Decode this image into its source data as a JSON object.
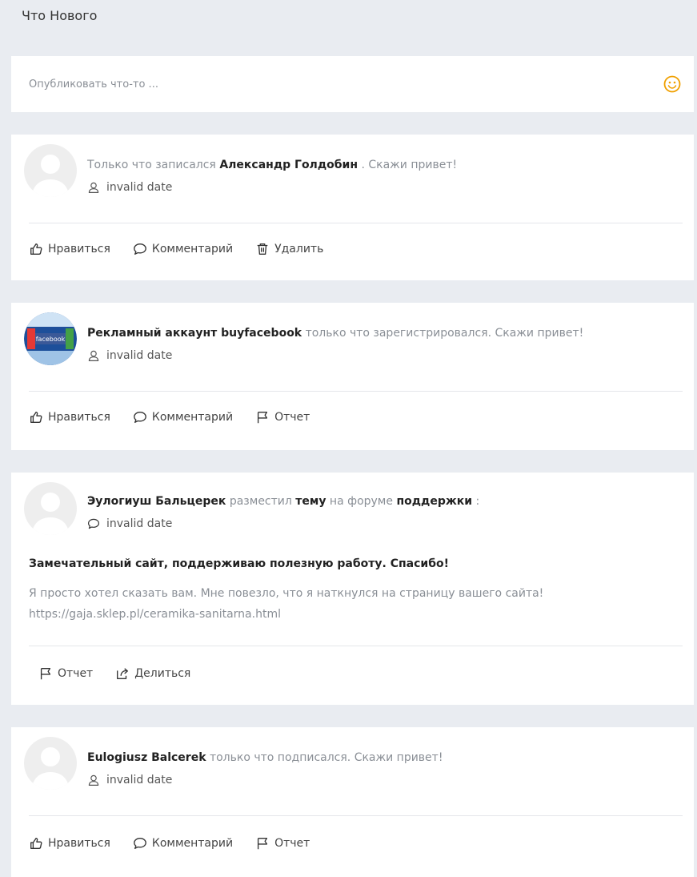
{
  "page_title": "Что Нового",
  "composer": {
    "placeholder": "Опубликовать что-то ...",
    "emoji_icon": "smiley-icon",
    "accent": "#f0a000"
  },
  "posts": [
    {
      "prefix": "Только что записался",
      "name": "Александр Голдобин",
      "suffix": ". Скажи привет!",
      "meta_icon": "user-icon",
      "meta_text": "invalid date",
      "actions": [
        "Нравиться",
        "Комментарий",
        "Удалить"
      ]
    },
    {
      "name": "Рекламный аккаунт buyfacebook",
      "suffix": " только что зарегистрировался. Скажи привет!",
      "meta_icon": "user-icon",
      "meta_text": "invalid date",
      "avatar_text": "facebook",
      "actions": [
        "Нравиться",
        "Комментарий",
        "Отчет"
      ]
    },
    {
      "name": "Эулогиуш Бальцерек",
      "mid1": " разместил ",
      "link1": "тему",
      "mid2": " на форуме ",
      "link2": "поддержки",
      "suffix": " :",
      "meta_icon": "comment-icon",
      "meta_text": "invalid date",
      "title": "Замечательный сайт, поддерживаю полезную работу. Спасибо!",
      "body_line1": "Я просто хотел сказать вам. Мне повезло, что я наткнулся на страницу вашего сайта!",
      "body_line2": "https://gaja.sklep.pl/ceramika-sanitarna.html",
      "actions": [
        "Отчет",
        "Делиться"
      ]
    },
    {
      "name": "Eulogiusz Balcerek",
      "suffix": " только что подписался. Скажи привет!",
      "meta_icon": "user-icon",
      "meta_text": "invalid date",
      "actions": [
        "Нравиться",
        "Комментарий",
        "Отчет"
      ]
    }
  ]
}
